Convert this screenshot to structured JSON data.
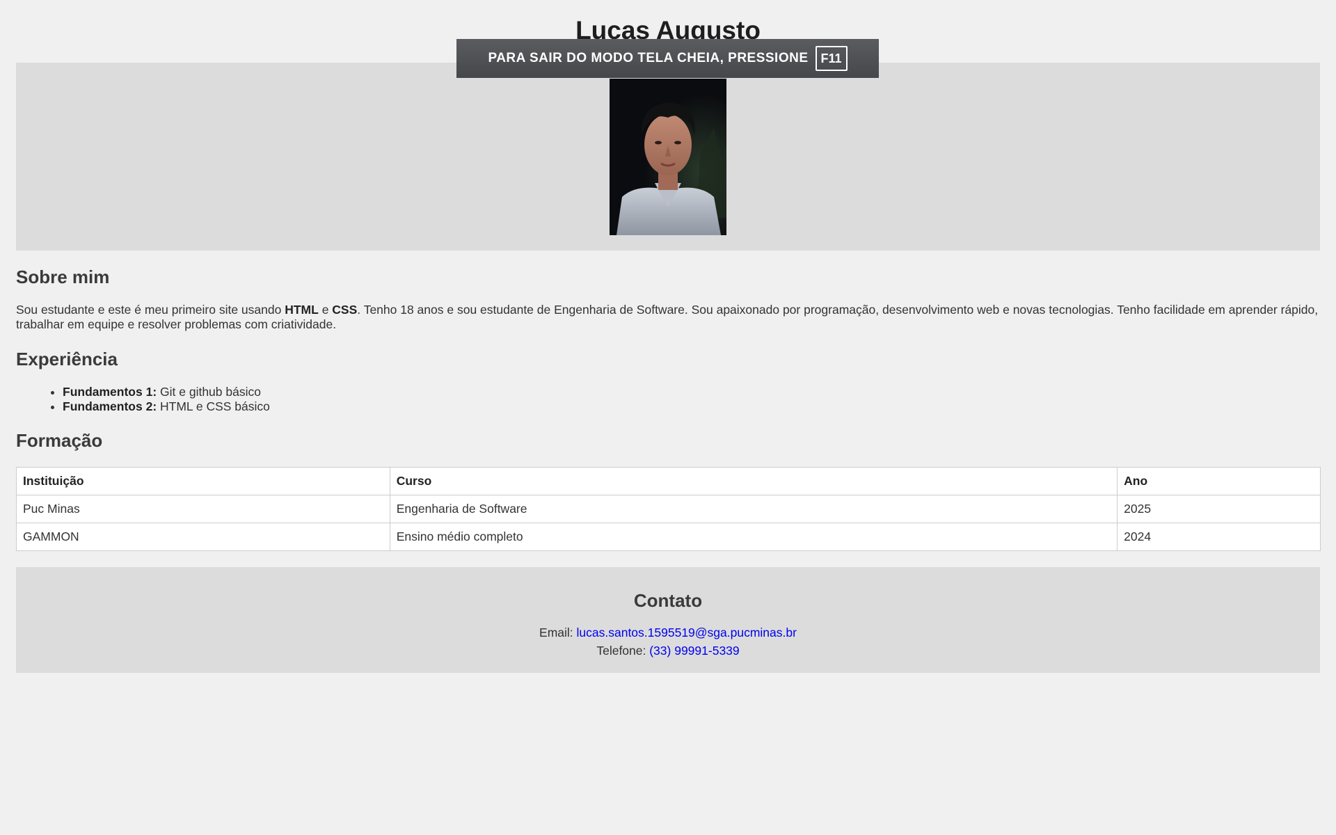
{
  "header": {
    "name": "Lucas Augusto"
  },
  "fullscreen_notice": {
    "text": "PARA SAIR DO MODO TELA CHEIA, PRESSIONE",
    "key": "F11"
  },
  "about": {
    "heading": "Sobre mim",
    "text_before_html": "Sou estudante e este é meu primeiro site usando ",
    "html_label": "HTML",
    "connector": " e ",
    "css_label": "CSS",
    "text_after_css": ". Tenho 18 anos e sou estudante de Engenharia de Software. Sou apaixonado por programação, desenvolvimento web e novas tecnologias. Tenho facilidade em aprender rápido, trabalhar em equipe e resolver problemas com criatividade."
  },
  "experience": {
    "heading": "Experiência",
    "items": [
      {
        "label": "Fundamentos 1:",
        "text": " Git e github básico"
      },
      {
        "label": "Fundamentos 2:",
        "text": " HTML e CSS básico"
      }
    ]
  },
  "education": {
    "heading": "Formação",
    "columns": [
      "Instituição",
      "Curso",
      "Ano"
    ],
    "rows": [
      [
        "Puc Minas",
        "Engenharia de Software",
        "2025"
      ],
      [
        "GAMMON",
        "Ensino médio completo",
        "2024"
      ]
    ]
  },
  "contact": {
    "heading": "Contato",
    "email_label": "Email: ",
    "email": "lucas.santos.1595519@sga.pucminas.br",
    "phone_label": "Telefone: ",
    "phone": "(33) 99991-5339"
  },
  "colors": {
    "page_bg": "#f0f0f0",
    "banner_bg": "#dcdcdc",
    "link": "#0000ee",
    "notice_bg": "#4f5155"
  }
}
